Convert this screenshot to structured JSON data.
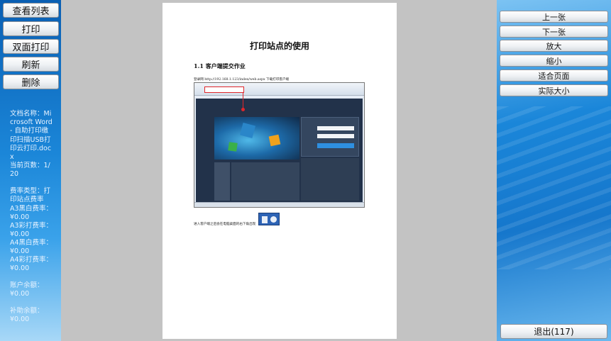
{
  "left": {
    "buttons": [
      {
        "label": "查看列表",
        "name": "view-list-button"
      },
      {
        "label": "打印",
        "name": "print-button"
      },
      {
        "label": "双面打印",
        "name": "duplex-print-button"
      },
      {
        "label": "刷新",
        "name": "refresh-button"
      },
      {
        "label": "删除",
        "name": "delete-button"
      }
    ],
    "info": {
      "doc": "文档名称：Microsoft Word - 自助打印缴印扫描USB打印云打印.docx",
      "page": "当前页数：1/20",
      "fees": "费率类型：打印站点费率",
      "a3_bw": "A3黑白费率：¥0.00",
      "a3_color": "A3彩打费率：¥0.00",
      "a4_bw": "A4黑白费率：¥0.00",
      "a4_color": "A4彩打费率：¥0.00",
      "balance": "账户余额：¥0.00",
      "subsidy": "补助余额：¥0.00"
    }
  },
  "right": {
    "buttons": [
      {
        "label": "上一张",
        "name": "previous-page-button"
      },
      {
        "label": "下一张",
        "name": "next-page-button"
      },
      {
        "label": "放大",
        "name": "zoom-in-button"
      },
      {
        "label": "缩小",
        "name": "zoom-out-button"
      },
      {
        "label": "适合页面",
        "name": "fit-page-button"
      },
      {
        "label": "实际大小",
        "name": "actual-size-button"
      }
    ],
    "exit_label": "退出(117)"
  },
  "document": {
    "title": "打印站点的使用",
    "section": "1.1  客户端提交作业",
    "para1": "登录网 http://192.168.1.123/index/web.aspx 下载打印客户端",
    "para2": "进入客户端之后会在电脑桌面的右下角出现"
  },
  "colors": {
    "left_panel": "#0a5fb3",
    "right_panel": "#1a86d9",
    "viewer_background": "#c3c3c3",
    "annotation_red": "#e0262b"
  }
}
